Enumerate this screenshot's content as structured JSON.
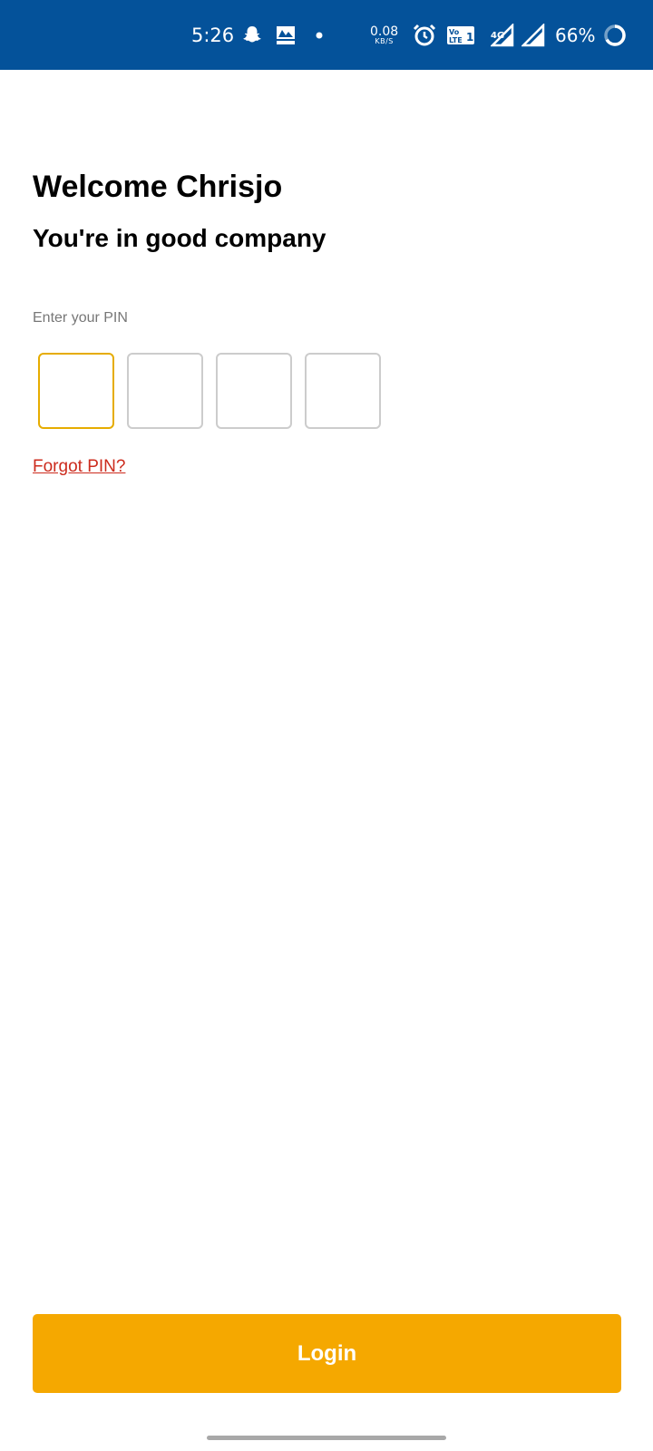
{
  "status_bar": {
    "time": "5:26",
    "net_speed_value": "0.08",
    "net_speed_unit": "KB/S",
    "network_type": "4G",
    "battery": "66%",
    "icons": [
      "snapchat-icon",
      "news-icon",
      "notification-dot-icon",
      "alarm-icon",
      "volte-icon",
      "signal-icon",
      "signal-icon",
      "battery-ring-icon"
    ]
  },
  "header": {
    "title": "Welcome Chrisjo",
    "subtitle": "You're in good company"
  },
  "pin": {
    "label": "Enter your PIN",
    "digits": [
      "",
      "",
      "",
      ""
    ],
    "active_index": 0
  },
  "links": {
    "forgot_pin": "Forgot PIN?"
  },
  "actions": {
    "login_label": "Login"
  },
  "colors": {
    "status_bar": "#04529a",
    "accent": "#f5a800",
    "active_border": "#e6ac00",
    "link": "#cc2b1d"
  }
}
